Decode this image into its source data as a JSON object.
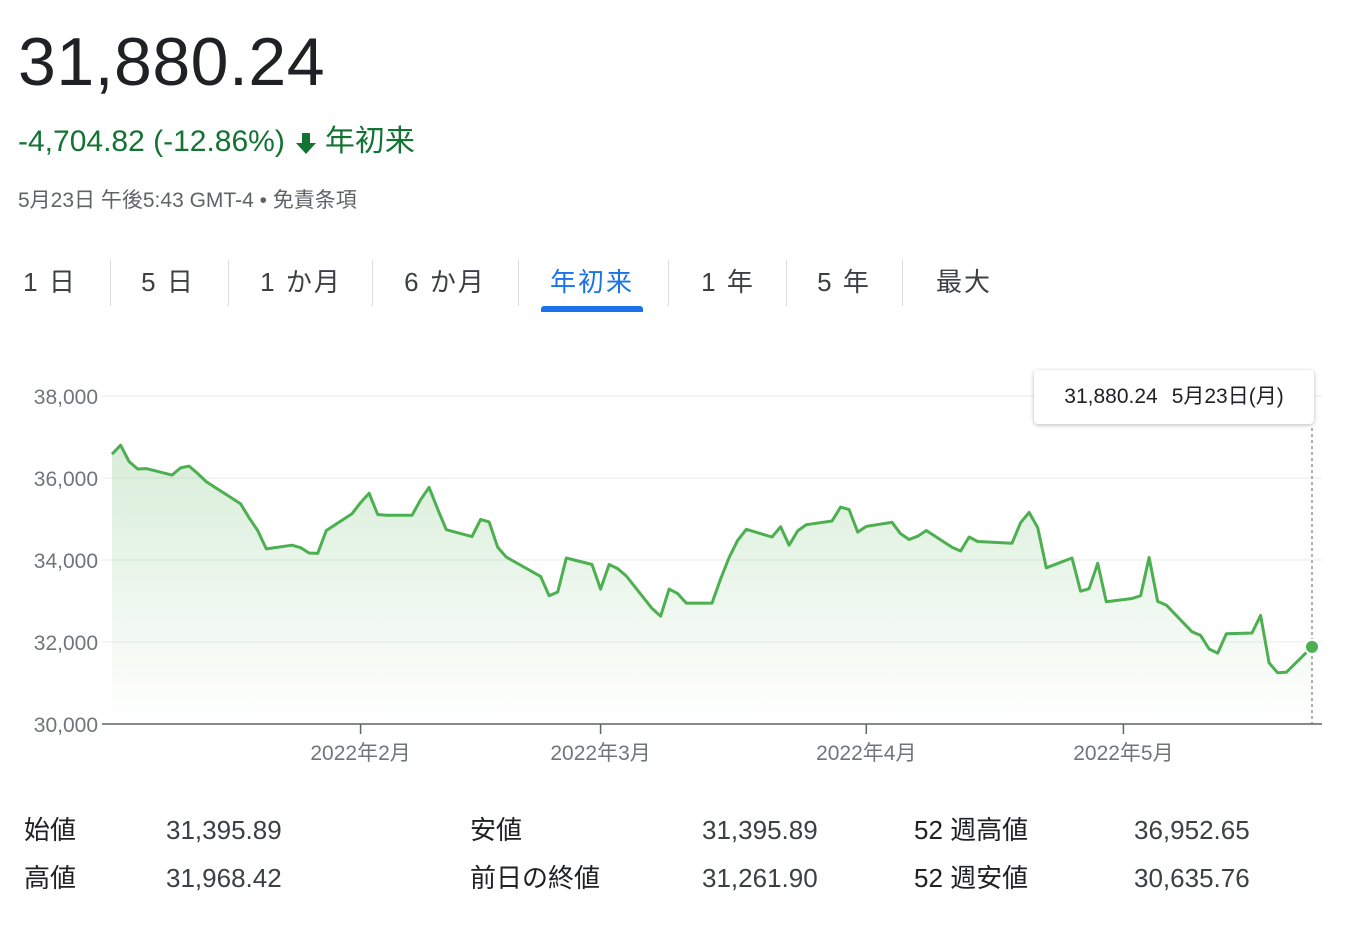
{
  "quote": {
    "price": "31,880.24",
    "change_text": "-4,704.82 (-12.86%)",
    "change_period": "年初来",
    "change_color": "#137333",
    "timestamp": "5月23日 午後5:43 GMT-4",
    "separator": "•",
    "disclaimer": "免責条項"
  },
  "tabs": [
    {
      "label": "1 日",
      "active": false
    },
    {
      "label": "5 日",
      "active": false
    },
    {
      "label": "1 か月",
      "active": false
    },
    {
      "label": "6 か月",
      "active": false
    },
    {
      "label": "年初来",
      "active": true
    },
    {
      "label": "1 年",
      "active": false
    },
    {
      "label": "5 年",
      "active": false
    },
    {
      "label": "最大",
      "active": false
    }
  ],
  "tooltip": {
    "value": "31,880.24",
    "date": "5月23日(月)"
  },
  "chart_data": {
    "type": "area",
    "ylim": [
      30000,
      38000
    ],
    "y_ticks": [
      30000,
      32000,
      34000,
      36000,
      38000
    ],
    "y_tick_labels": [
      "30,000",
      "32,000",
      "34,000",
      "36,000",
      "38,000"
    ],
    "x_tick_labels": [
      "2022年2月",
      "2022年3月",
      "2022年4月",
      "2022年5月"
    ],
    "grid": true,
    "line_color": "#4caf50",
    "series": [
      {
        "x": [
          "2022-01-03",
          "2022-01-04",
          "2022-01-05",
          "2022-01-06",
          "2022-01-07",
          "2022-01-10",
          "2022-01-11",
          "2022-01-12",
          "2022-01-13",
          "2022-01-14",
          "2022-01-18",
          "2022-01-19",
          "2022-01-20",
          "2022-01-21",
          "2022-01-24",
          "2022-01-25",
          "2022-01-26",
          "2022-01-27",
          "2022-01-28",
          "2022-01-31",
          "2022-02-01",
          "2022-02-02",
          "2022-02-03",
          "2022-02-04",
          "2022-02-07",
          "2022-02-08",
          "2022-02-09",
          "2022-02-10",
          "2022-02-11",
          "2022-02-14",
          "2022-02-15",
          "2022-02-16",
          "2022-02-17",
          "2022-02-18",
          "2022-02-22",
          "2022-02-23",
          "2022-02-24",
          "2022-02-25",
          "2022-02-28",
          "2022-03-01",
          "2022-03-02",
          "2022-03-03",
          "2022-03-04",
          "2022-03-07",
          "2022-03-08",
          "2022-03-09",
          "2022-03-10",
          "2022-03-11",
          "2022-03-14",
          "2022-03-15",
          "2022-03-16",
          "2022-03-17",
          "2022-03-18",
          "2022-03-21",
          "2022-03-22",
          "2022-03-23",
          "2022-03-24",
          "2022-03-25",
          "2022-03-28",
          "2022-03-29",
          "2022-03-30",
          "2022-03-31",
          "2022-04-01",
          "2022-04-04",
          "2022-04-05",
          "2022-04-06",
          "2022-04-07",
          "2022-04-08",
          "2022-04-11",
          "2022-04-12",
          "2022-04-13",
          "2022-04-14",
          "2022-04-18",
          "2022-04-19",
          "2022-04-20",
          "2022-04-21",
          "2022-04-22",
          "2022-04-25",
          "2022-04-26",
          "2022-04-27",
          "2022-04-28",
          "2022-04-29",
          "2022-05-02",
          "2022-05-03",
          "2022-05-04",
          "2022-05-05",
          "2022-05-06",
          "2022-05-09",
          "2022-05-10",
          "2022-05-11",
          "2022-05-12",
          "2022-05-13",
          "2022-05-16",
          "2022-05-17",
          "2022-05-18",
          "2022-05-19",
          "2022-05-20",
          "2022-05-23"
        ],
        "values": [
          36580,
          36800,
          36400,
          36220,
          36230,
          36070,
          36250,
          36290,
          36110,
          35910,
          35370,
          35030,
          34720,
          34270,
          34360,
          34300,
          34170,
          34160,
          34720,
          35130,
          35400,
          35630,
          35110,
          35090,
          35090,
          35470,
          35770,
          35240,
          34740,
          34570,
          34990,
          34930,
          34310,
          34070,
          33600,
          33130,
          33220,
          34050,
          33890,
          33290,
          33890,
          33790,
          33610,
          32820,
          32630,
          33290,
          33180,
          32950,
          32950,
          33540,
          34060,
          34480,
          34750,
          34560,
          34810,
          34360,
          34710,
          34860,
          34950,
          35290,
          35230,
          34680,
          34820,
          34920,
          34640,
          34500,
          34580,
          34720,
          34310,
          34220,
          34560,
          34450,
          34410,
          34910,
          35160,
          34790,
          33810,
          34050,
          33240,
          33300,
          33920,
          32980,
          33060,
          33130,
          34060,
          32990,
          32900,
          32250,
          32160,
          31830,
          31730,
          32200,
          32220,
          32650,
          31490,
          31250,
          31260,
          31880
        ]
      }
    ]
  },
  "stats": [
    {
      "label": "始値",
      "value": "31,395.89"
    },
    {
      "label": "高値",
      "value": "31,968.42"
    },
    {
      "label": "安値",
      "value": "31,395.89"
    },
    {
      "label": "前日の終値",
      "value": "31,261.90"
    },
    {
      "label": "52 週高値",
      "value": "36,952.65"
    },
    {
      "label": "52 週安値",
      "value": "30,635.76"
    }
  ]
}
